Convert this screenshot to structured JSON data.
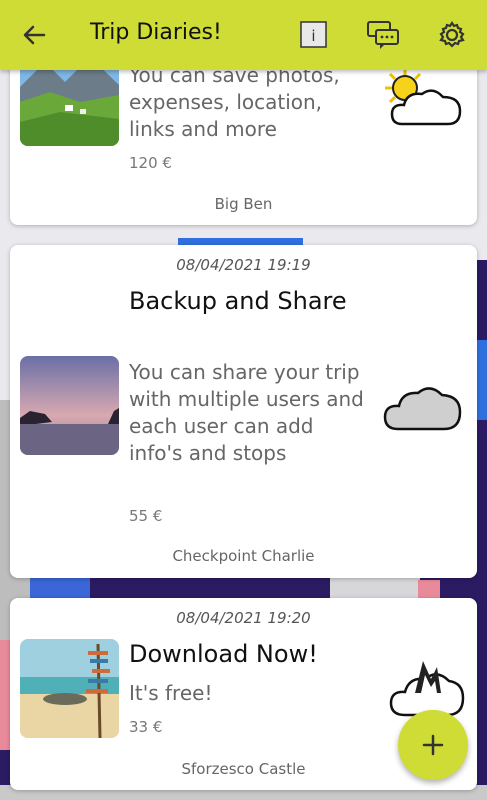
{
  "app": {
    "title": "Trip Diaries!",
    "accent_color": "#cfdc35",
    "icons": {
      "back": "arrow-left-icon",
      "info": "info-icon",
      "chat": "chat-icon",
      "settings": "gear-icon",
      "add": "plus-icon"
    }
  },
  "cards": [
    {
      "desc": "You can save photos, expenses, location, links and more",
      "price": "120 €",
      "place": "Big Ben",
      "weather": "sun-cloud-icon"
    },
    {
      "date": "08/04/2021 19:19",
      "title": "Backup and Share",
      "desc": "You can share your trip with multiple users and each user can add info's and stops",
      "price": "55 €",
      "place": "Checkpoint Charlie",
      "weather": "cloud-icon"
    },
    {
      "date": "08/04/2021 19:20",
      "title": "Download Now!",
      "desc": "It's free!",
      "price": "33 €",
      "place": "Sforzesco Castle",
      "weather": "storm-cloud-icon"
    }
  ]
}
